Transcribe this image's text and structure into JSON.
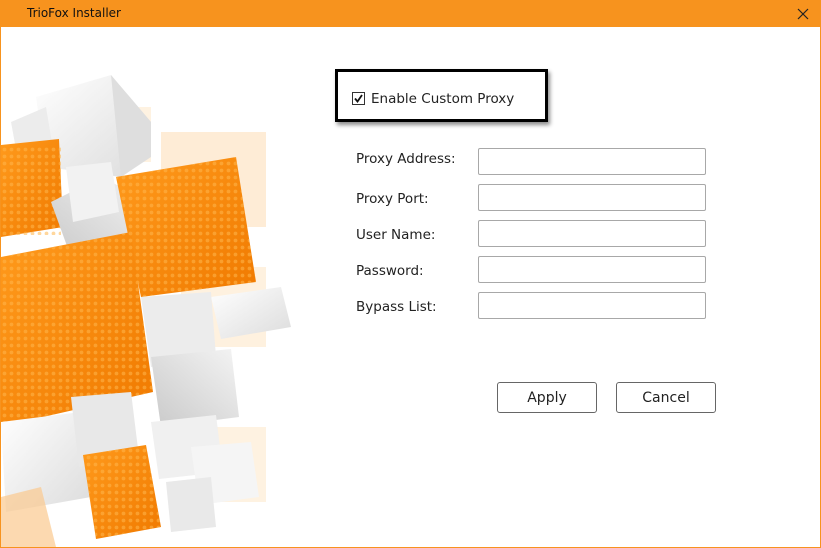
{
  "window": {
    "title": "TrioFox Installer",
    "accent_color": "#f7931e",
    "close_icon": "close-icon"
  },
  "proxy_form": {
    "enable_custom_proxy": {
      "label": "Enable Custom Proxy",
      "checked": true
    },
    "fields": [
      {
        "label": "Proxy Address:",
        "value": ""
      },
      {
        "label": "Proxy Port:",
        "value": ""
      },
      {
        "label": "User Name:",
        "value": ""
      },
      {
        "label": "Password:",
        "value": ""
      },
      {
        "label": "Bypass List:",
        "value": ""
      }
    ],
    "buttons": {
      "apply": "Apply",
      "cancel": "Cancel"
    }
  }
}
